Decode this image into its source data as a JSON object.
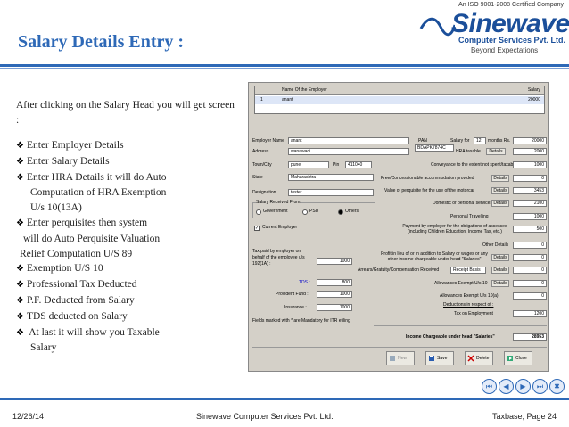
{
  "slide": {
    "title": "Salary Details Entry :",
    "intro": "After clicking on the Salary Head you will get screen :",
    "bullets": [
      "Enter Employer Details",
      "Enter Salary Details",
      "Enter HRA Details it will do Auto",
      "Computation of HRA Exemption",
      "U/s 10(13A)",
      "Enter perquisites then system",
      "will do Auto Perquisite Valuation",
      "Relief Computation U/S 89",
      "Exemption U/S 10",
      "Professional Tax Deducted",
      "P.F. Deducted from Salary",
      "TDS deducted on Salary",
      " At last it will show you Taxable",
      "Salary"
    ],
    "bullet_glyph": "❖"
  },
  "logo": {
    "iso": "An ISO 9001-2008 Certified Company",
    "name": "Sinewave",
    "sub": "Computer Services Pvt. Ltd.",
    "tagline": "Beyond Expectations"
  },
  "app": {
    "grid_headers": [
      "Name Of the Employer",
      "Salary"
    ],
    "grid_row": {
      "no": "1",
      "name": "anant",
      "salary": "20000"
    },
    "employer_name_label": "Employer Name",
    "employer_name": "anant",
    "address_label": "Address",
    "address": "wanawadi",
    "town_label": "Town/City",
    "town": "pune",
    "pin_label": "Pin",
    "pin": "411040",
    "state_label": "State",
    "state": "Maharashtra",
    "designation_label": "Designation",
    "designation": "tester",
    "salary_from_label": "Salary Received From",
    "salary_from_options": [
      "Government",
      "PSU",
      "Others"
    ],
    "current_employer": "Current Employer",
    "pan_label": "PAN",
    "pan": "BDAPK7874C",
    "salary_for_label": "Salary for",
    "months": "12",
    "months_label": "months Rs.",
    "salary_value": "20000",
    "hra_label": "HRA taxable",
    "details": "Details",
    "hra_value": "2000",
    "right_rows": [
      {
        "label": "Conveyance to the extent not spent/taxable",
        "value": "1000"
      },
      {
        "label": "Free/Concessionable accommodation provided",
        "value": "0"
      },
      {
        "label": "Value of perquisite for the use of the motorcar",
        "value": "3453"
      },
      {
        "label": "Domestic or personal services",
        "value": "2100"
      },
      {
        "label": "Personal Travelling",
        "value": "1000"
      },
      {
        "label": "Payment by employer for the obligations of assessee (including Children Education, Income Tax, etc.)",
        "value": "500"
      },
      {
        "label": "Other Details",
        "value": "0"
      },
      {
        "label": "Profit in lieu of or in addition to Salary or wages or any other income chargeable under head \"Salaries\"",
        "value": "0"
      },
      {
        "label": "Arrears/Gratuity/Compensation Received",
        "value": "0"
      },
      {
        "label": "Allowances Exempt U/s 10",
        "value": "0"
      },
      {
        "label": "Allowances Exempt U/s 10(a)",
        "value": "0"
      },
      {
        "label": "Tax on Employment",
        "value": "1200"
      }
    ],
    "receipt_basis": "Receipt Basis",
    "deductions_label": "Deductions in respect of :",
    "tax_paid_label": "Tax paid by employer on behalf of the employee u/s 192(1A) :",
    "tax_paid": "1000",
    "tds_label": "TDS :",
    "tds": "800",
    "pf_label": "Provident Fund :",
    "pf": "1000",
    "insurance_label": "Insurance :",
    "insurance": "1000",
    "mandatory_note": "Fields marked with * are Mandatory for ITR efiling",
    "income_label": "Income Chargeable under head \"Salaries\"",
    "income_value": "28953",
    "buttons": [
      "New",
      "Save",
      "Delete",
      "Close"
    ]
  },
  "nav": [
    "⏮",
    "◀",
    "▶",
    "⏭",
    "✖"
  ],
  "footer": {
    "date": "12/26/14",
    "company": "Sinewave Computer Services Pvt. Ltd.",
    "page": "Taxbase, Page 24"
  }
}
